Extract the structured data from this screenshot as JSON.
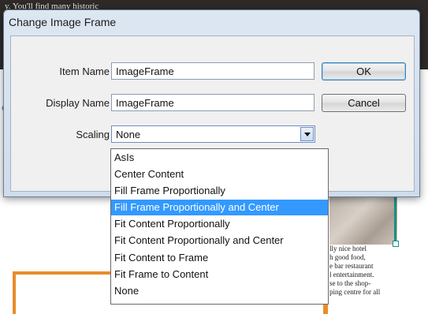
{
  "background": {
    "top_text": "y. You'll find many historic",
    "article_lines": [
      "lly nice hotel",
      "h good food,",
      "e bar restaurant",
      "l entertainment.",
      "se to the shop-",
      "ping centre for all"
    ]
  },
  "dialog": {
    "title": "Change Image Frame",
    "item_name_label": "Item Name",
    "item_name_value": "ImageFrame",
    "display_name_label": "Display Name",
    "display_name_value": "ImageFrame",
    "scaling_label": "Scaling",
    "scaling_value": "None",
    "ok_label": "OK",
    "cancel_label": "Cancel"
  },
  "dropdown": {
    "selected_index": 3,
    "options": [
      "AsIs",
      "Center Content",
      "Fill Frame Proportionally",
      "Fill Frame Proportionally and Center",
      "Fit Content Proportionally",
      "Fit Content Proportionally and Center",
      "Fit Content to Frame",
      "Fit Frame to Content",
      "None"
    ]
  }
}
